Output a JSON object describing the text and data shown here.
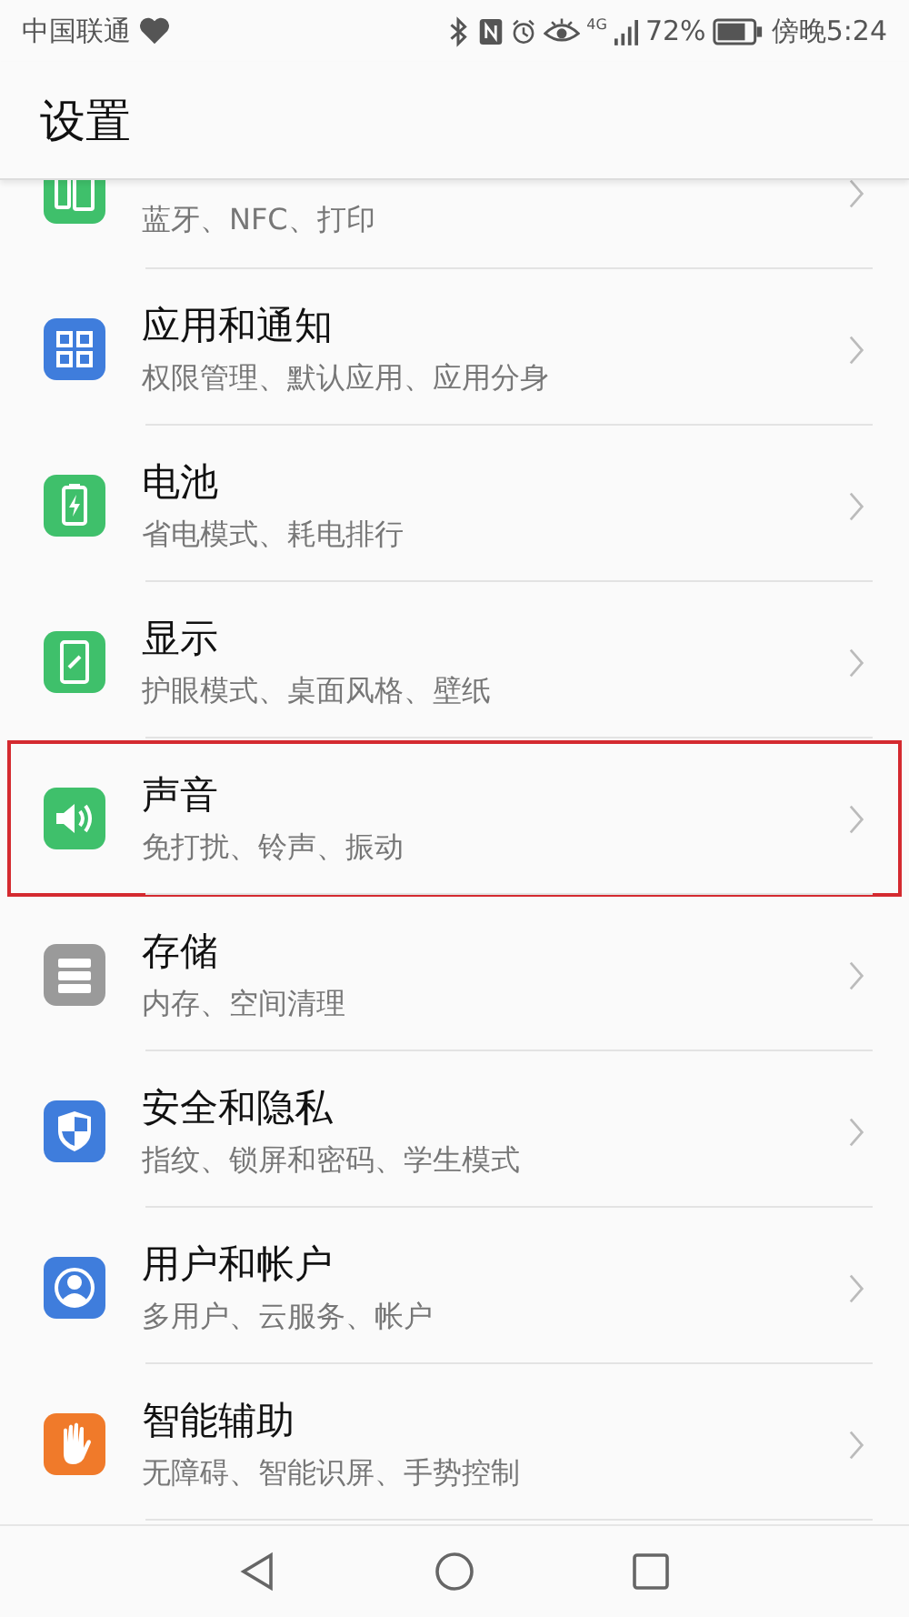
{
  "status_bar": {
    "carrier": "中国联通",
    "network": "4G",
    "battery_text": "72%",
    "time": "傍晚5:24"
  },
  "header": {
    "title": "设置"
  },
  "items": [
    {
      "kind": "partial",
      "subtitle": "蓝牙、NFC、打印",
      "highlighted": false
    },
    {
      "kind": "full",
      "title": "应用和通知",
      "subtitle": "权限管理、默认应用、应用分身",
      "highlighted": false
    },
    {
      "kind": "full",
      "title": "电池",
      "subtitle": "省电模式、耗电排行",
      "highlighted": false
    },
    {
      "kind": "full",
      "title": "显示",
      "subtitle": "护眼模式、桌面风格、壁纸",
      "highlighted": false
    },
    {
      "kind": "full",
      "title": "声音",
      "subtitle": "免打扰、铃声、振动",
      "highlighted": true
    },
    {
      "kind": "full",
      "title": "存储",
      "subtitle": "内存、空间清理",
      "highlighted": false
    },
    {
      "kind": "full",
      "title": "安全和隐私",
      "subtitle": "指纹、锁屏和密码、学生模式",
      "highlighted": false
    },
    {
      "kind": "full",
      "title": "用户和帐户",
      "subtitle": "多用户、云服务、帐户",
      "highlighted": false
    },
    {
      "kind": "full",
      "title": "智能辅助",
      "subtitle": "无障碍、智能识屏、手势控制",
      "highlighted": false
    }
  ]
}
